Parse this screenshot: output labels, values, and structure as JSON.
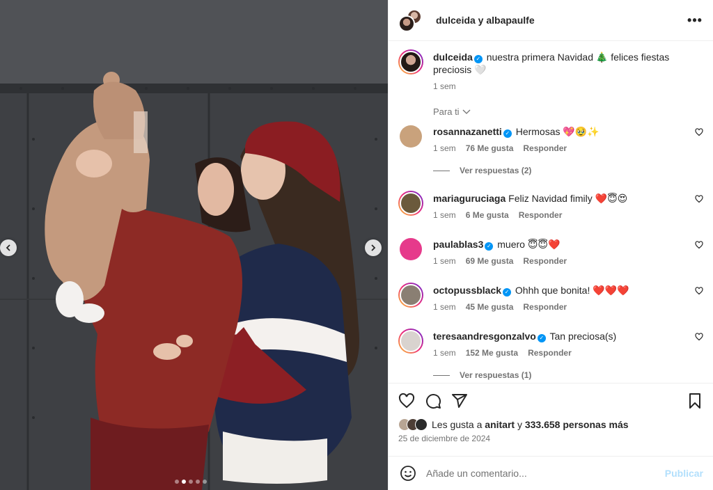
{
  "header": {
    "title": "dulceida y albapaulfe",
    "more_label": "•••"
  },
  "caption": {
    "username": "dulceida",
    "text": "nuestra primera Navidad 🎄 felices fiestas preciosis 🤍",
    "time": "1 sem"
  },
  "for_you_label": "Para ti",
  "comments": [
    {
      "username": "rosannazanetti",
      "verified": true,
      "text": "Hermosas 💖🥹✨",
      "time": "1 sem",
      "likes": "76 Me gusta",
      "reply": "Responder",
      "replies": "Ver respuestas (2)",
      "avatar_color": "#c9a27c"
    },
    {
      "username": "mariaguruciaga",
      "verified": false,
      "text": "Feliz Navidad fimily ❤️😇😍",
      "time": "1 sem",
      "likes": "6 Me gusta",
      "reply": "Responder",
      "replies": "",
      "avatar_color": "#6b5a3c"
    },
    {
      "username": "paulablas3",
      "verified": true,
      "text": "muero 😇😇❤️",
      "time": "1 sem",
      "likes": "69 Me gusta",
      "reply": "Responder",
      "replies": "",
      "avatar_color": "#e63a8b"
    },
    {
      "username": "octopussblack",
      "verified": true,
      "text": "Ohhh que bonita! ❤️❤️❤️",
      "time": "1 sem",
      "likes": "45 Me gusta",
      "reply": "Responder",
      "replies": "",
      "avatar_color": "#8a7f73"
    },
    {
      "username": "teresaandresgonzalvo",
      "verified": true,
      "text": "Tan preciosa(s)",
      "time": "1 sem",
      "likes": "152 Me gusta",
      "reply": "Responder",
      "replies": "Ver respuestas (1)",
      "avatar_color": "#d9d3cf"
    }
  ],
  "likes": {
    "prefix": "Les gusta a",
    "user": "anitart",
    "joiner": "y",
    "count": "333.658 personas más"
  },
  "date": "25 de diciembre de 2024",
  "comment_input": {
    "placeholder": "Añade un comentario...",
    "publish_label": "Publicar"
  },
  "carousel": {
    "total": 5,
    "active_index": 1
  },
  "colors": {
    "verified": "#0095f6",
    "publish_disabled": "#b2dffc",
    "muted_text": "#737373"
  }
}
